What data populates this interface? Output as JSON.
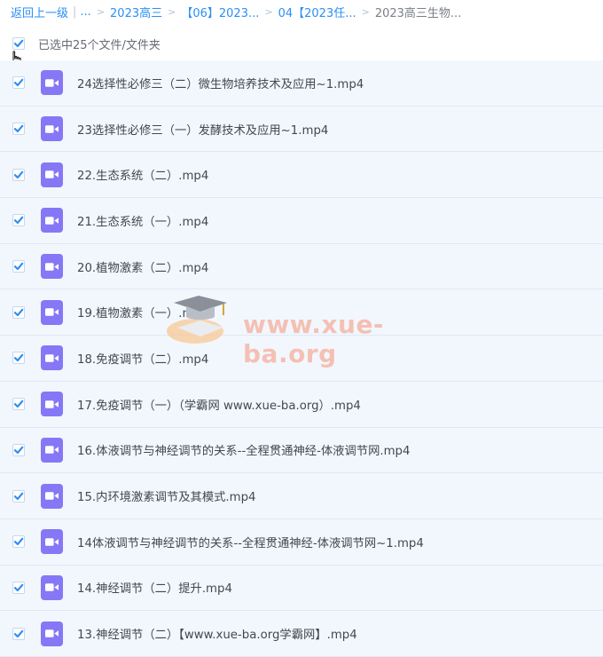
{
  "breadcrumb": {
    "back_label": "返回上一级",
    "ellipsis": "...",
    "pipe": "|",
    "items": [
      "2023高三",
      "【06】2023...",
      "04【2023任...",
      "2023高三生物..."
    ]
  },
  "selection": {
    "label": "已选中25个文件/文件夹"
  },
  "files": [
    {
      "name": "24选择性必修三（二）微生物培养技术及应用~1.mp4"
    },
    {
      "name": "23选择性必修三（一）发酵技术及应用~1.mp4"
    },
    {
      "name": "22.生态系统（二）.mp4"
    },
    {
      "name": "21.生态系统（一）.mp4"
    },
    {
      "name": "20.植物激素（二）.mp4"
    },
    {
      "name": "19.植物激素（一）.mp4"
    },
    {
      "name": "18.免疫调节（二）.mp4"
    },
    {
      "name": "17.免疫调节（一）（学霸网 www.xue-ba.org）.mp4"
    },
    {
      "name": "16.体液调节与神经调节的关系--全程贯通神经-体液调节网.mp4"
    },
    {
      "name": "15.内环境激素调节及其模式.mp4"
    },
    {
      "name": "14体液调节与神经调节的关系--全程贯通神经-体液调节网~1.mp4"
    },
    {
      "name": "14.神经调节（二）提升.mp4"
    },
    {
      "name": "13.神经调节（二）【www.xue-ba.org学霸网】.mp4"
    }
  ],
  "watermark": {
    "text": "www.xue-ba.org"
  },
  "icons": {
    "checkbox": "checkmark-icon",
    "file": "video-file-icon",
    "cursor": "hand-pointer-icon"
  },
  "colors": {
    "accent": "#2a8ff7",
    "row_bg": "#f2f7fd",
    "file_icon": "#8677f7",
    "checkmark": "#2f8ff3"
  }
}
